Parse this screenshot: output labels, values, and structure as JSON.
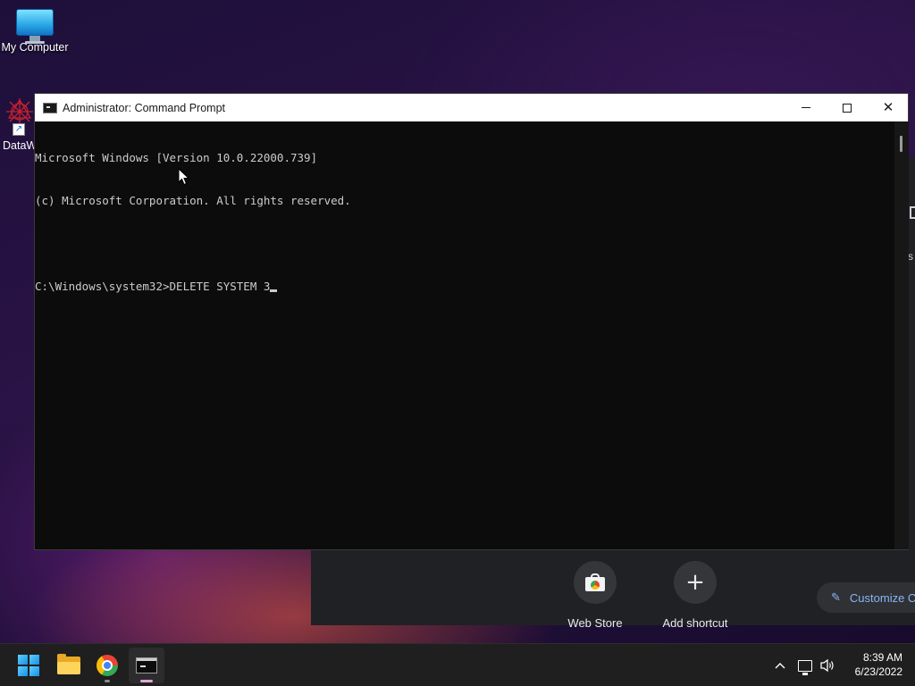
{
  "desktop": {
    "icons": [
      {
        "label": "My Computer",
        "icon": "monitor-icon"
      },
      {
        "label": "DataW",
        "icon": "datawrapper-shortcut-icon"
      }
    ]
  },
  "background_browser": {
    "shortcuts": [
      {
        "label": "Web Store",
        "icon": "web-store-icon"
      },
      {
        "label": "Add shortcut",
        "icon": "plus-icon"
      }
    ],
    "customize_label": "Customize C",
    "customize_icon": "pencil-icon"
  },
  "cmd_window": {
    "title": "Administrator: Command Prompt",
    "lines": [
      "Microsoft Windows [Version 10.0.22000.739]",
      "(c) Microsoft Corporation. All rights reserved.",
      "",
      "C:\\Windows\\system32>DELETE SYSTEM 3"
    ],
    "controls": {
      "minimize": "minimize-icon",
      "maximize": "maximize-icon",
      "close": "close-icon"
    }
  },
  "taskbar": {
    "apps": [
      {
        "name": "Start",
        "icon": "windows-logo-icon"
      },
      {
        "name": "File Explorer",
        "icon": "folder-icon"
      },
      {
        "name": "Google Chrome",
        "icon": "chrome-icon"
      },
      {
        "name": "Command Prompt",
        "icon": "cmd-icon"
      }
    ],
    "tray": {
      "chevron": "^",
      "network_icon": "network-icon",
      "volume_icon": "volume-icon"
    },
    "clock": {
      "time": "8:39 AM",
      "date": "6/23/2022"
    }
  },
  "colors": {
    "console_bg": "#0c0c0c",
    "console_text": "#cccccc",
    "taskbar_bg": "#1f1f1f",
    "accent_link": "#8ab4f8"
  }
}
